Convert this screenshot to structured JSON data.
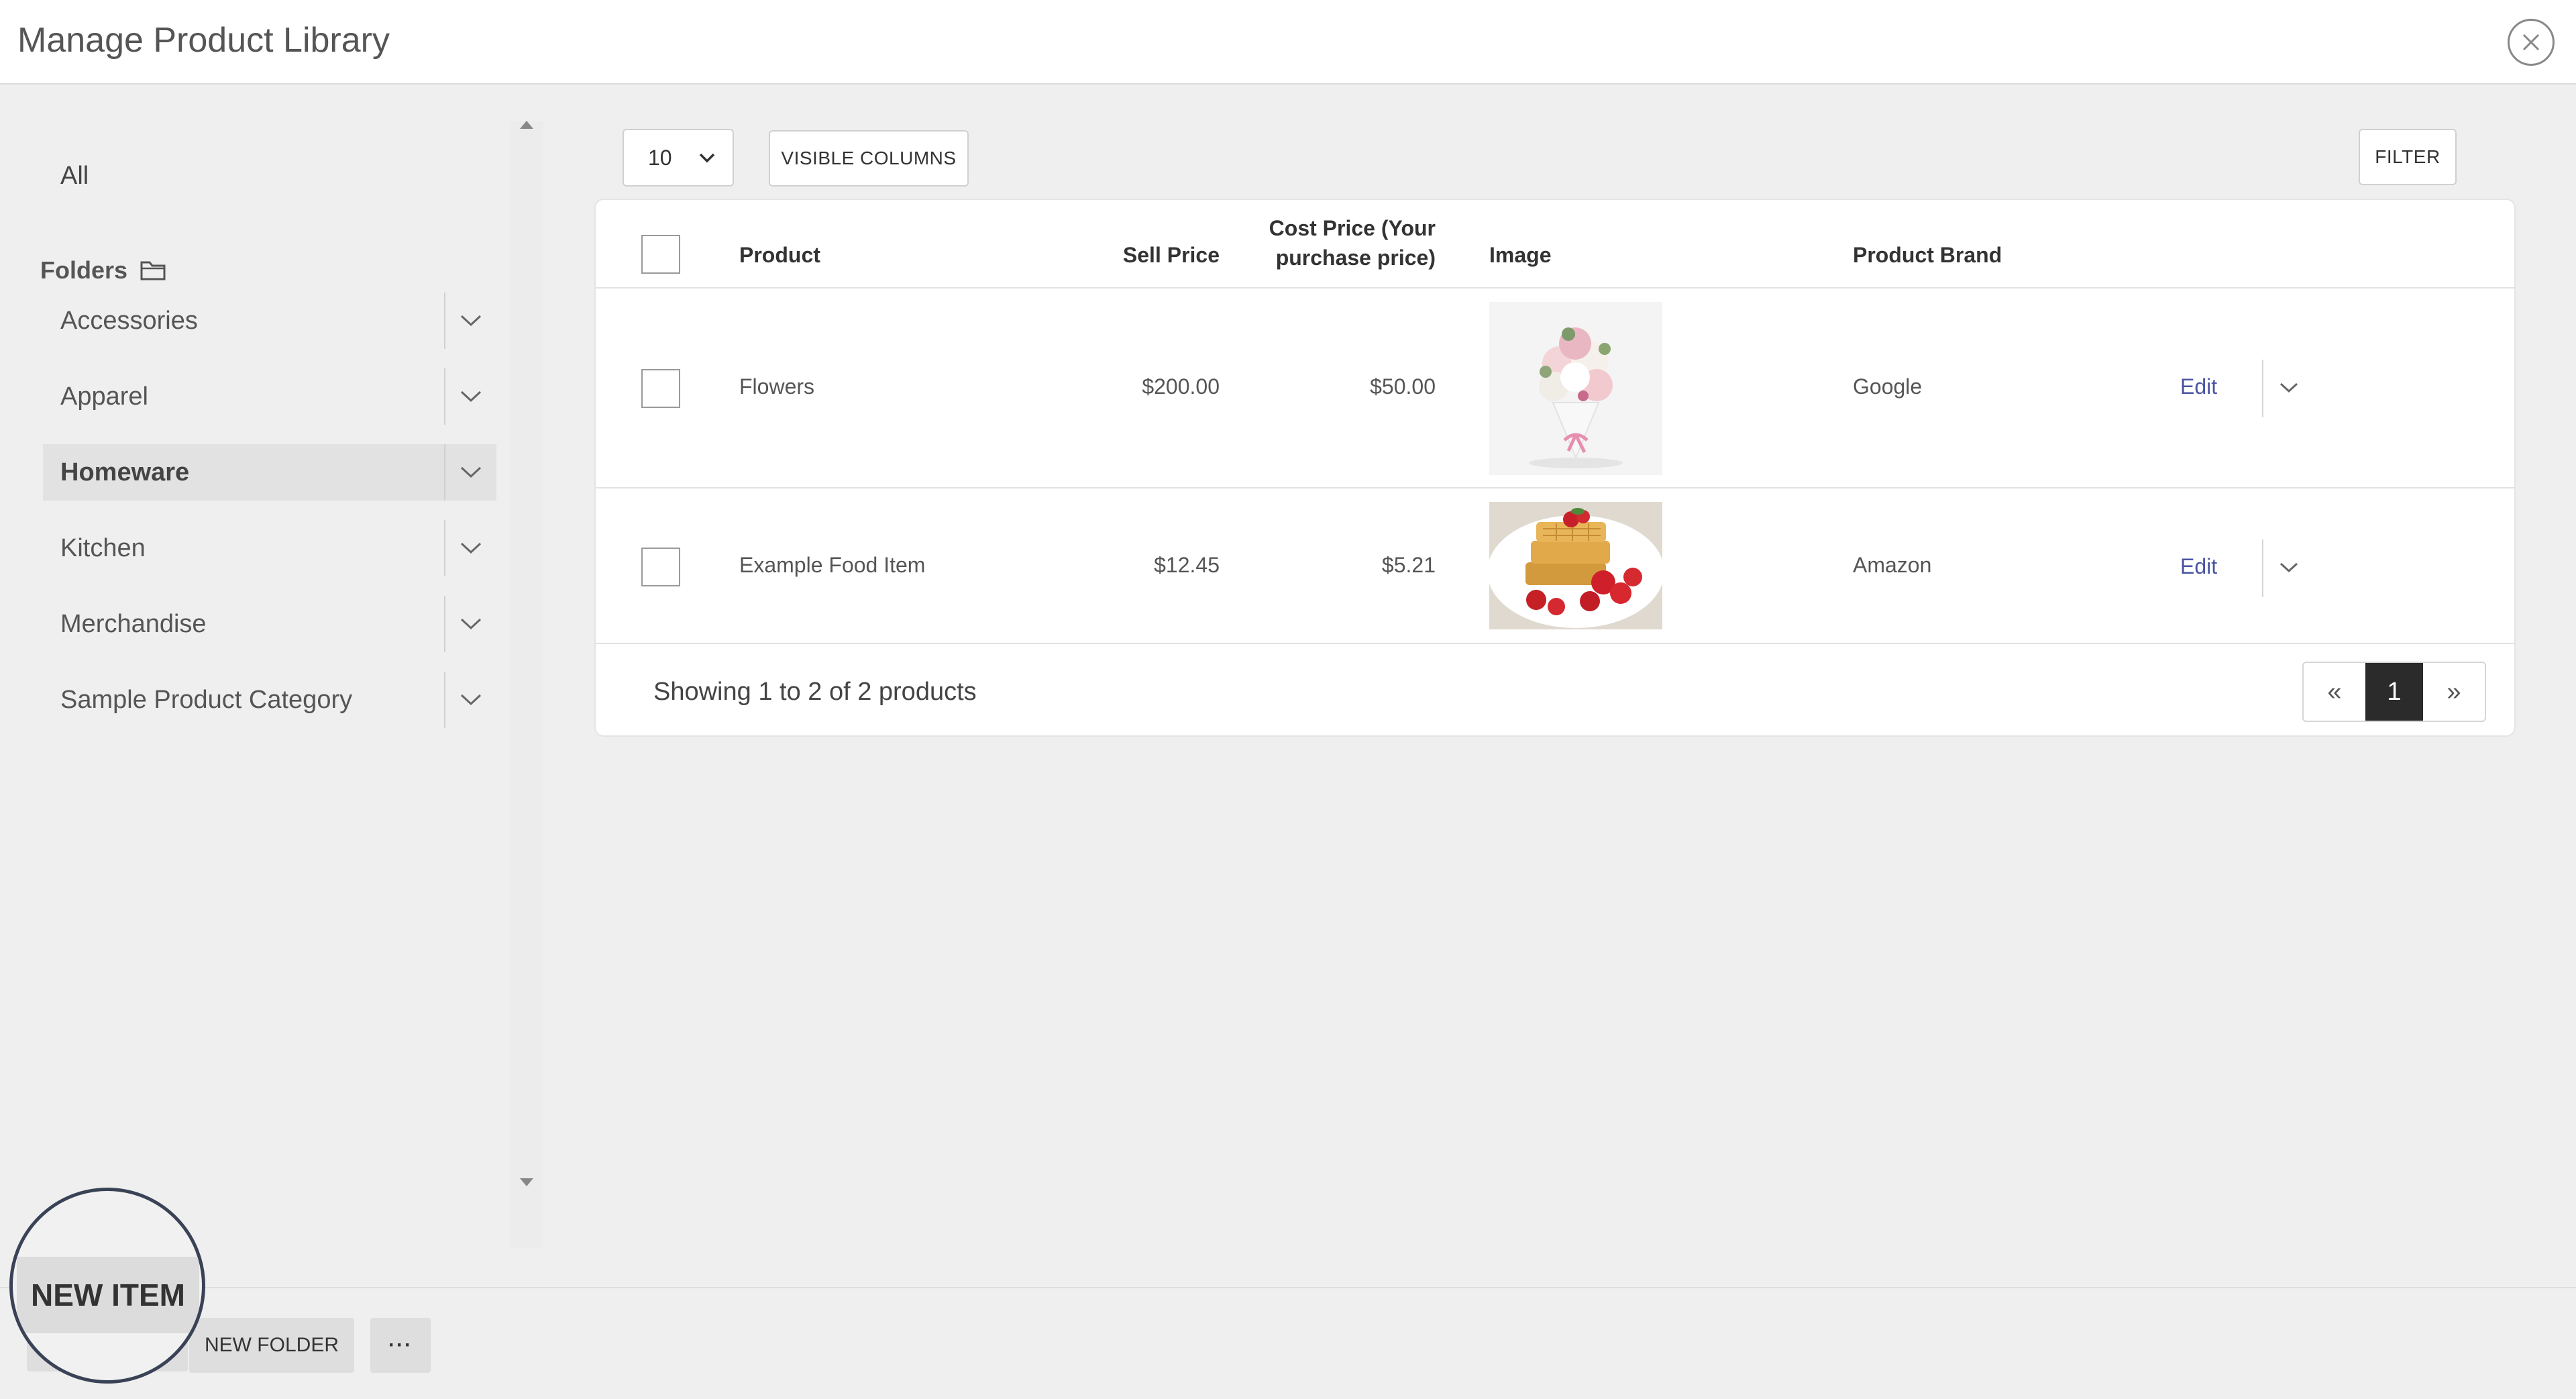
{
  "header": {
    "title": "Manage Product Library",
    "close_icon": "close-circle-icon"
  },
  "sidebar": {
    "all_label": "All",
    "folders_label": "Folders",
    "folders_icon": "folder-icon",
    "items": [
      {
        "label": "Accessories",
        "active": false
      },
      {
        "label": "Apparel",
        "active": false
      },
      {
        "label": "Homeware",
        "active": true
      },
      {
        "label": "Kitchen",
        "active": false
      },
      {
        "label": "Merchandise",
        "active": false
      },
      {
        "label": "Sample Product Category",
        "active": false
      }
    ]
  },
  "toolbar": {
    "page_size": "10",
    "visible_columns_label": "VISIBLE COLUMNS",
    "filter_label": "FILTER"
  },
  "table": {
    "columns": {
      "product": "Product",
      "sell_price": "Sell Price",
      "cost_price": "Cost Price (Your purchase price)",
      "image": "Image",
      "brand": "Product Brand"
    },
    "rows": [
      {
        "product": "Flowers",
        "sell_price": "$200.00",
        "cost_price": "$50.00",
        "image": "flower-bouquet-image",
        "brand": "Google",
        "edit_label": "Edit"
      },
      {
        "product": "Example Food Item",
        "sell_price": "$12.45",
        "cost_price": "$5.21",
        "image": "waffles-image",
        "brand": "Amazon",
        "edit_label": "Edit"
      }
    ],
    "footer": {
      "showing_text": "Showing 1 to 2 of 2 products",
      "prev_label": "«",
      "current_page": "1",
      "next_label": "»"
    }
  },
  "bottom_bar": {
    "new_item_label": "NEW ITEM",
    "new_folder_label": "NEW FOLDER",
    "more_label": "···"
  },
  "colors": {
    "accent_link": "#4a55a2",
    "active_page": "#2b2b2b",
    "background": "#efefef"
  }
}
